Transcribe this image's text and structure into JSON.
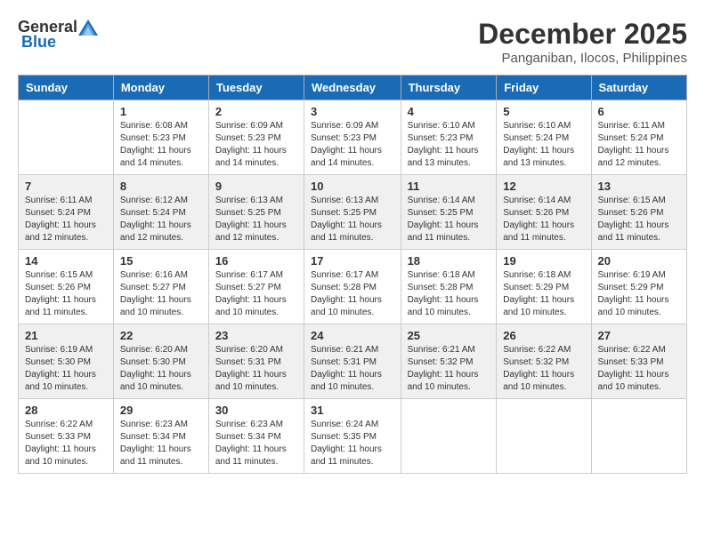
{
  "header": {
    "logo_general": "General",
    "logo_blue": "Blue",
    "month": "December 2025",
    "location": "Panganiban, Ilocos, Philippines"
  },
  "days_of_week": [
    "Sunday",
    "Monday",
    "Tuesday",
    "Wednesday",
    "Thursday",
    "Friday",
    "Saturday"
  ],
  "weeks": [
    [
      {
        "day": "",
        "sunrise": "",
        "sunset": "",
        "daylight": ""
      },
      {
        "day": "1",
        "sunrise": "Sunrise: 6:08 AM",
        "sunset": "Sunset: 5:23 PM",
        "daylight": "Daylight: 11 hours and 14 minutes."
      },
      {
        "day": "2",
        "sunrise": "Sunrise: 6:09 AM",
        "sunset": "Sunset: 5:23 PM",
        "daylight": "Daylight: 11 hours and 14 minutes."
      },
      {
        "day": "3",
        "sunrise": "Sunrise: 6:09 AM",
        "sunset": "Sunset: 5:23 PM",
        "daylight": "Daylight: 11 hours and 14 minutes."
      },
      {
        "day": "4",
        "sunrise": "Sunrise: 6:10 AM",
        "sunset": "Sunset: 5:23 PM",
        "daylight": "Daylight: 11 hours and 13 minutes."
      },
      {
        "day": "5",
        "sunrise": "Sunrise: 6:10 AM",
        "sunset": "Sunset: 5:24 PM",
        "daylight": "Daylight: 11 hours and 13 minutes."
      },
      {
        "day": "6",
        "sunrise": "Sunrise: 6:11 AM",
        "sunset": "Sunset: 5:24 PM",
        "daylight": "Daylight: 11 hours and 12 minutes."
      }
    ],
    [
      {
        "day": "7",
        "sunrise": "Sunrise: 6:11 AM",
        "sunset": "Sunset: 5:24 PM",
        "daylight": "Daylight: 11 hours and 12 minutes."
      },
      {
        "day": "8",
        "sunrise": "Sunrise: 6:12 AM",
        "sunset": "Sunset: 5:24 PM",
        "daylight": "Daylight: 11 hours and 12 minutes."
      },
      {
        "day": "9",
        "sunrise": "Sunrise: 6:13 AM",
        "sunset": "Sunset: 5:25 PM",
        "daylight": "Daylight: 11 hours and 12 minutes."
      },
      {
        "day": "10",
        "sunrise": "Sunrise: 6:13 AM",
        "sunset": "Sunset: 5:25 PM",
        "daylight": "Daylight: 11 hours and 11 minutes."
      },
      {
        "day": "11",
        "sunrise": "Sunrise: 6:14 AM",
        "sunset": "Sunset: 5:25 PM",
        "daylight": "Daylight: 11 hours and 11 minutes."
      },
      {
        "day": "12",
        "sunrise": "Sunrise: 6:14 AM",
        "sunset": "Sunset: 5:26 PM",
        "daylight": "Daylight: 11 hours and 11 minutes."
      },
      {
        "day": "13",
        "sunrise": "Sunrise: 6:15 AM",
        "sunset": "Sunset: 5:26 PM",
        "daylight": "Daylight: 11 hours and 11 minutes."
      }
    ],
    [
      {
        "day": "14",
        "sunrise": "Sunrise: 6:15 AM",
        "sunset": "Sunset: 5:26 PM",
        "daylight": "Daylight: 11 hours and 11 minutes."
      },
      {
        "day": "15",
        "sunrise": "Sunrise: 6:16 AM",
        "sunset": "Sunset: 5:27 PM",
        "daylight": "Daylight: 11 hours and 10 minutes."
      },
      {
        "day": "16",
        "sunrise": "Sunrise: 6:17 AM",
        "sunset": "Sunset: 5:27 PM",
        "daylight": "Daylight: 11 hours and 10 minutes."
      },
      {
        "day": "17",
        "sunrise": "Sunrise: 6:17 AM",
        "sunset": "Sunset: 5:28 PM",
        "daylight": "Daylight: 11 hours and 10 minutes."
      },
      {
        "day": "18",
        "sunrise": "Sunrise: 6:18 AM",
        "sunset": "Sunset: 5:28 PM",
        "daylight": "Daylight: 11 hours and 10 minutes."
      },
      {
        "day": "19",
        "sunrise": "Sunrise: 6:18 AM",
        "sunset": "Sunset: 5:29 PM",
        "daylight": "Daylight: 11 hours and 10 minutes."
      },
      {
        "day": "20",
        "sunrise": "Sunrise: 6:19 AM",
        "sunset": "Sunset: 5:29 PM",
        "daylight": "Daylight: 11 hours and 10 minutes."
      }
    ],
    [
      {
        "day": "21",
        "sunrise": "Sunrise: 6:19 AM",
        "sunset": "Sunset: 5:30 PM",
        "daylight": "Daylight: 11 hours and 10 minutes."
      },
      {
        "day": "22",
        "sunrise": "Sunrise: 6:20 AM",
        "sunset": "Sunset: 5:30 PM",
        "daylight": "Daylight: 11 hours and 10 minutes."
      },
      {
        "day": "23",
        "sunrise": "Sunrise: 6:20 AM",
        "sunset": "Sunset: 5:31 PM",
        "daylight": "Daylight: 11 hours and 10 minutes."
      },
      {
        "day": "24",
        "sunrise": "Sunrise: 6:21 AM",
        "sunset": "Sunset: 5:31 PM",
        "daylight": "Daylight: 11 hours and 10 minutes."
      },
      {
        "day": "25",
        "sunrise": "Sunrise: 6:21 AM",
        "sunset": "Sunset: 5:32 PM",
        "daylight": "Daylight: 11 hours and 10 minutes."
      },
      {
        "day": "26",
        "sunrise": "Sunrise: 6:22 AM",
        "sunset": "Sunset: 5:32 PM",
        "daylight": "Daylight: 11 hours and 10 minutes."
      },
      {
        "day": "27",
        "sunrise": "Sunrise: 6:22 AM",
        "sunset": "Sunset: 5:33 PM",
        "daylight": "Daylight: 11 hours and 10 minutes."
      }
    ],
    [
      {
        "day": "28",
        "sunrise": "Sunrise: 6:22 AM",
        "sunset": "Sunset: 5:33 PM",
        "daylight": "Daylight: 11 hours and 10 minutes."
      },
      {
        "day": "29",
        "sunrise": "Sunrise: 6:23 AM",
        "sunset": "Sunset: 5:34 PM",
        "daylight": "Daylight: 11 hours and 11 minutes."
      },
      {
        "day": "30",
        "sunrise": "Sunrise: 6:23 AM",
        "sunset": "Sunset: 5:34 PM",
        "daylight": "Daylight: 11 hours and 11 minutes."
      },
      {
        "day": "31",
        "sunrise": "Sunrise: 6:24 AM",
        "sunset": "Sunset: 5:35 PM",
        "daylight": "Daylight: 11 hours and 11 minutes."
      },
      {
        "day": "",
        "sunrise": "",
        "sunset": "",
        "daylight": ""
      },
      {
        "day": "",
        "sunrise": "",
        "sunset": "",
        "daylight": ""
      },
      {
        "day": "",
        "sunrise": "",
        "sunset": "",
        "daylight": ""
      }
    ]
  ]
}
